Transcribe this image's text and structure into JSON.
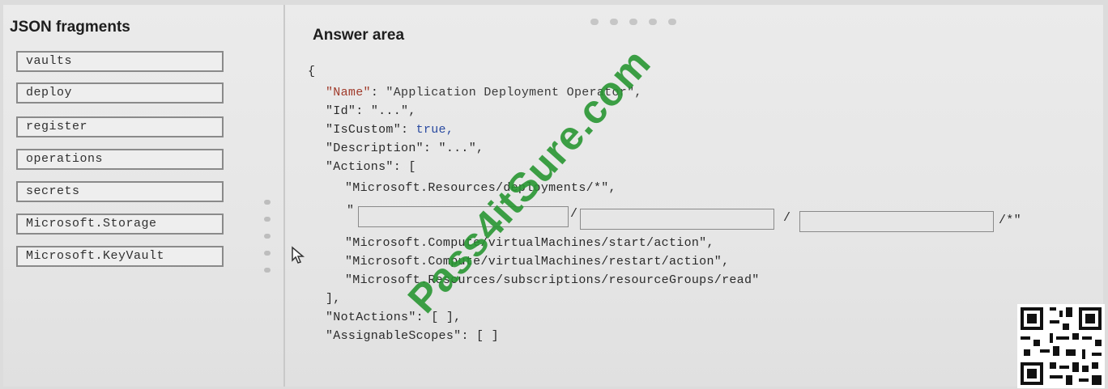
{
  "left_panel": {
    "title": "JSON fragments",
    "fragments": [
      "vaults",
      "deploy",
      "register",
      "operations",
      "secrets",
      "Microsoft.Storage",
      "Microsoft.KeyVault"
    ]
  },
  "answer_area": {
    "title": "Answer area",
    "open_brace": "{",
    "name_key": "\"Name\"",
    "name_value": "\"Application Deployment Operator\",",
    "id_key": "\"Id\"",
    "id_value": "\"...\",",
    "iscustom_key": "\"IsCustom\"",
    "iscustom_value": "true,",
    "description_key": "\"Description\"",
    "description_value": "\"...\",",
    "actions_key": "\"Actions\"",
    "actions_open": "[",
    "action_1": "\"Microsoft.Resources/deployments/*\",",
    "slot_line_prefix": "\"",
    "slot_sep_1": "/",
    "slot_sep_2": "/",
    "slot_suffix": "/*\"",
    "action_3": "\"Microsoft.Compute/virtualMachines/start/action\",",
    "action_4": "\"Microsoft.Compute/virtualMachines/restart/action\",",
    "action_5": "\"Microsoft.Resources/subscriptions/resourceGroups/read\"",
    "actions_close": "],",
    "notactions_key": "\"NotActions\"",
    "notactions_value": "[ ],",
    "assignable_key": "\"AssignableScopes\"",
    "assignable_value": "[ ]"
  },
  "watermark": "Pass4itSure.com",
  "colors": {
    "watermark": "#2e9a3a",
    "key": "#a03a2a",
    "keyword": "#2a4aa0"
  }
}
